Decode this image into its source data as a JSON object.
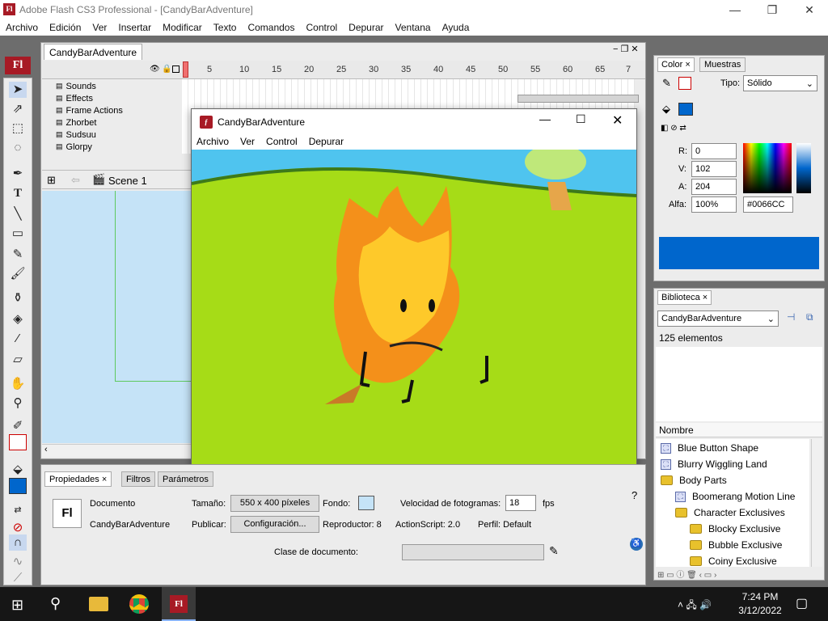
{
  "window": {
    "title": "Adobe Flash CS3 Professional - [CandyBarAdventure]",
    "app_icon": "Fl"
  },
  "menu": [
    "Archivo",
    "Edición",
    "Ver",
    "Insertar",
    "Modificar",
    "Texto",
    "Comandos",
    "Control",
    "Depurar",
    "Ventana",
    "Ayuda"
  ],
  "document": {
    "tab": "CandyBarAdventure",
    "scene": "Scene 1"
  },
  "timeline": {
    "layers": [
      "Sounds",
      "Effects",
      "Frame Actions",
      "Zhorbet",
      "Sudsuu",
      "Glorpy"
    ],
    "ruler": [
      "5",
      "10",
      "15",
      "20",
      "25",
      "30",
      "35",
      "40",
      "45",
      "50",
      "55",
      "60",
      "65",
      "7"
    ]
  },
  "player": {
    "title": "CandyBarAdventure",
    "menu": [
      "Archivo",
      "Ver",
      "Control",
      "Depurar"
    ]
  },
  "properties": {
    "tabs": [
      "Propiedades",
      "Filtros",
      "Parámetros"
    ],
    "doc_label": "Documento",
    "doc_name": "CandyBarAdventure",
    "size_label": "Tamaño:",
    "size_value": "550 x 400 píxeles",
    "bg_label": "Fondo:",
    "fps_label": "Velocidad de fotogramas:",
    "fps_value": "18",
    "fps_unit": "fps",
    "publish_label": "Publicar:",
    "publish_button": "Configuración...",
    "player_label": "Reproductor: 8",
    "actionscript_label": "ActionScript: 2.0",
    "profile_label": "Perfil: Default",
    "class_label": "Clase de documento:"
  },
  "color_panel": {
    "tabs": [
      "Color",
      "Muestras"
    ],
    "type_label": "Tipo:",
    "type_value": "Sólido",
    "r_label": "R:",
    "r_value": "0",
    "g_label": "V:",
    "g_value": "102",
    "b_label": "A:",
    "b_value": "204",
    "alpha_label": "Alfa:",
    "alpha_value": "100%",
    "hex_value": "#0066CC"
  },
  "library": {
    "tab": "Biblioteca",
    "source": "CandyBarAdventure",
    "count": "125 elementos",
    "col_header": "Nombre",
    "items": [
      {
        "label": "Blue Button Shape",
        "icon": "symbol-icon",
        "indent": 0
      },
      {
        "label": "Blurry Wiggling Land",
        "icon": "symbol-icon",
        "indent": 0
      },
      {
        "label": "Body Parts",
        "icon": "folder-icon",
        "indent": 0
      },
      {
        "label": "Boomerang Motion Line",
        "icon": "symbol-icon",
        "indent": 1
      },
      {
        "label": "Character Exclusives",
        "icon": "folder-icon",
        "indent": 1
      },
      {
        "label": "Blocky Exclusive",
        "icon": "folder-icon",
        "indent": 2
      },
      {
        "label": "Bubble Exclusive",
        "icon": "folder-icon",
        "indent": 2
      },
      {
        "label": "Coiny Exclusive",
        "icon": "folder-icon",
        "indent": 2
      }
    ]
  },
  "taskbar": {
    "time": "7:24 PM",
    "date": "3/12/2022",
    "app": "Fl"
  },
  "colors": {
    "accent": "#0066CC",
    "flash_red": "#a71a25",
    "grass": "#a6dc17",
    "sky": "#4fc4ef",
    "flame": "#f4901a"
  }
}
